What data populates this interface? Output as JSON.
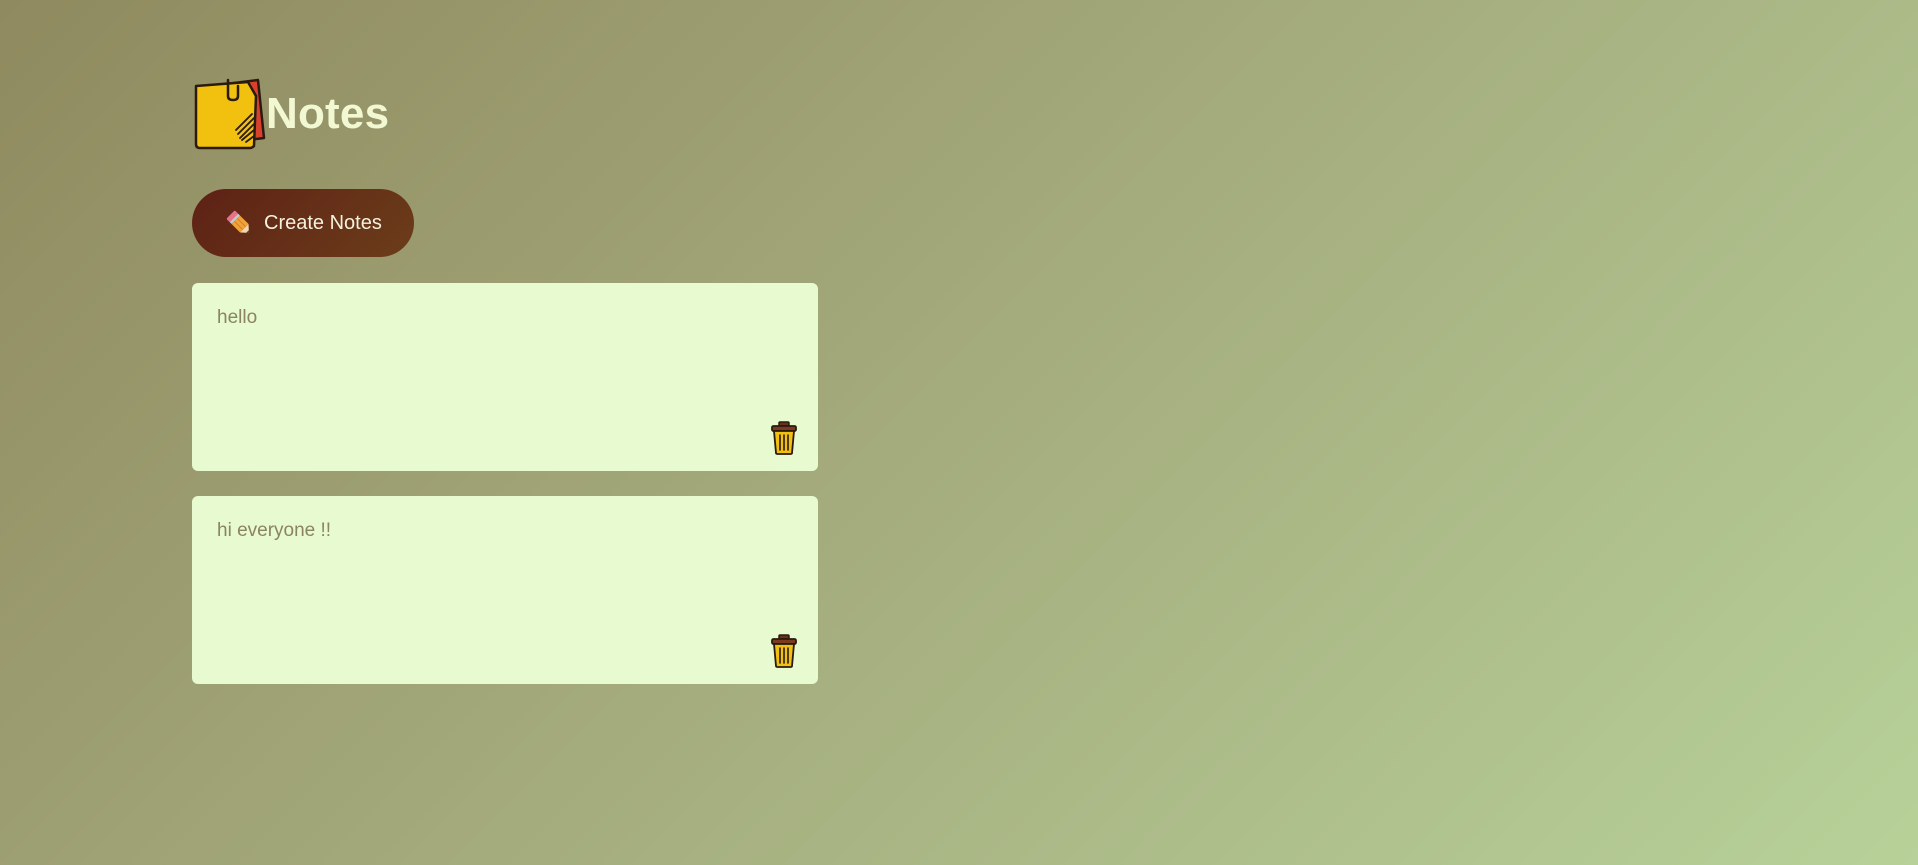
{
  "header": {
    "logo_icon": "sticky-notes-icon",
    "title": "Notes"
  },
  "toolbar": {
    "create_icon": "pencil-icon",
    "create_label": "Create Notes"
  },
  "notes": [
    {
      "text": "hello",
      "delete_icon": "trash-icon"
    },
    {
      "text": "hi everyone !!",
      "delete_icon": "trash-icon"
    }
  ],
  "colors": {
    "title": "#f2f9d2",
    "button_bg": "#5e2115",
    "note_bg": "#e8fad0",
    "note_text": "#8a8460",
    "icon_yellow": "#f2c00f",
    "icon_red": "#d9412c"
  }
}
